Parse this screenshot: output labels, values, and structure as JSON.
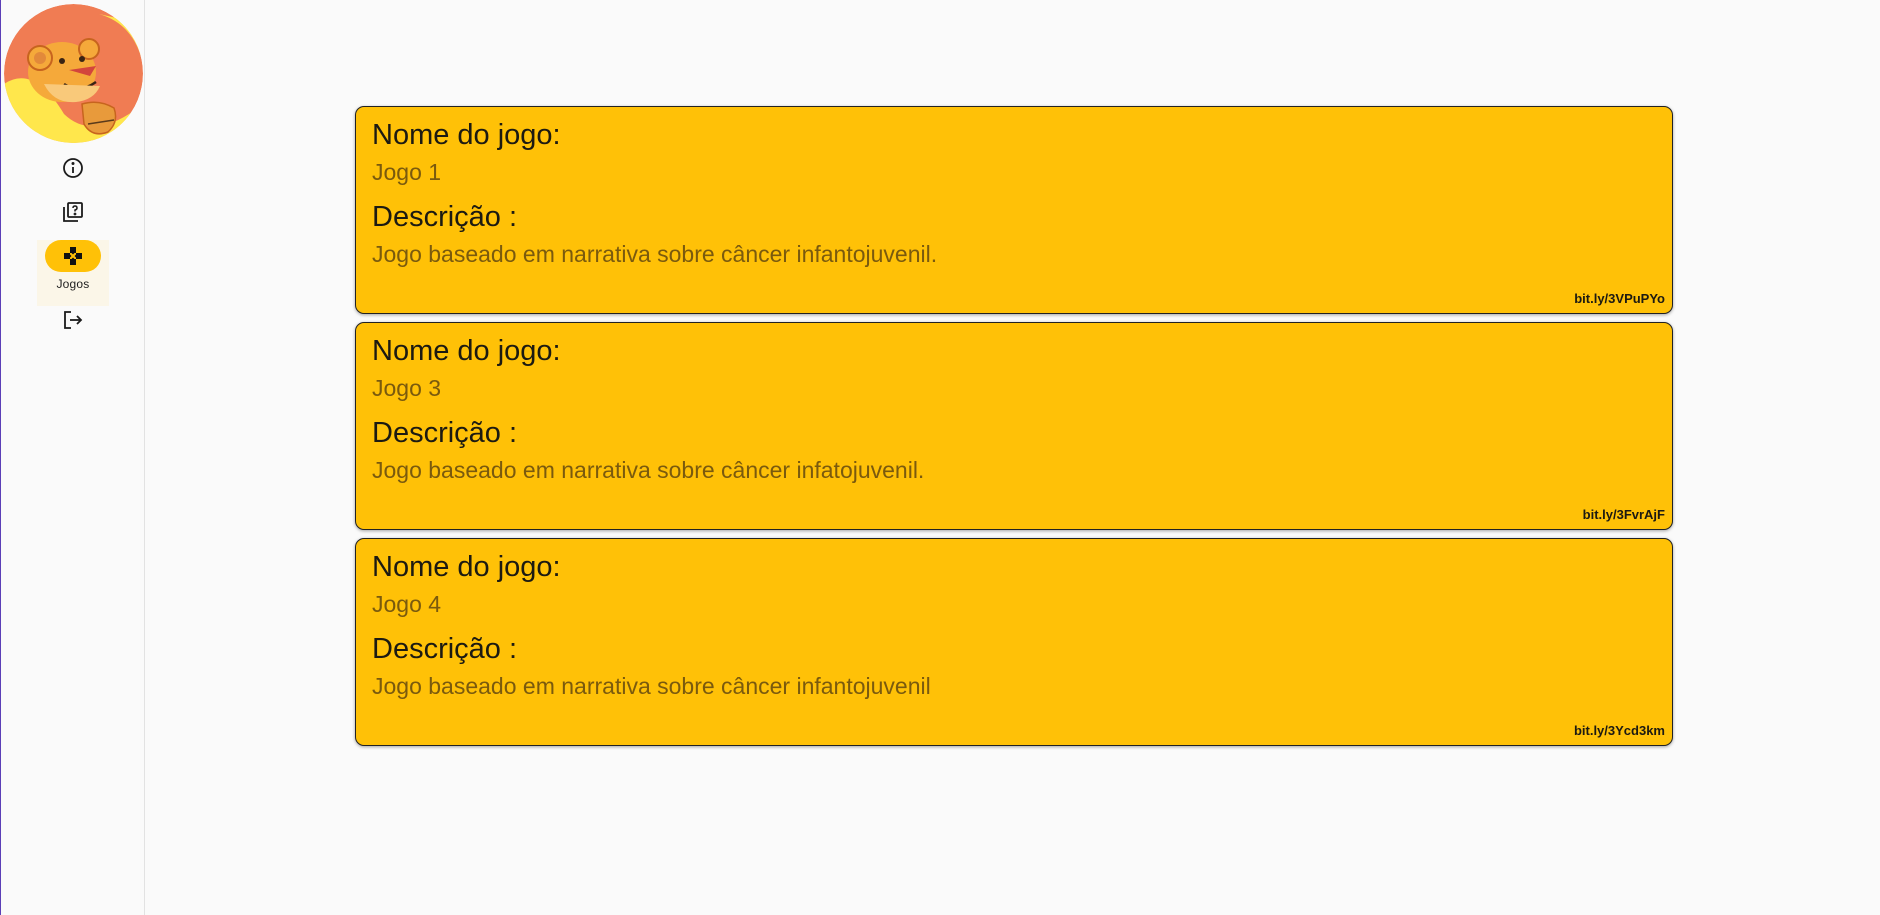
{
  "nav": {
    "items": [
      {
        "icon": "info-icon",
        "label": ""
      },
      {
        "icon": "quiz-icon",
        "label": ""
      },
      {
        "icon": "gamepad-icon",
        "label": "Jogos",
        "active": true
      },
      {
        "icon": "logout-icon",
        "label": ""
      }
    ]
  },
  "cards": [
    {
      "name_title": "Nome do jogo:",
      "name": "Jogo 1",
      "desc_title": "Descrição :",
      "desc": "Jogo baseado em narrativa sobre câncer infantojuvenil.",
      "link": "bit.ly/3VPuPYo"
    },
    {
      "name_title": "Nome do jogo:",
      "name": "Jogo 3",
      "desc_title": "Descrição :",
      "desc": "Jogo baseado em narrativa sobre câncer infatojuvenil.",
      "link": "bit.ly/3FvrAjF"
    },
    {
      "name_title": "Nome do jogo:",
      "name": "Jogo 4",
      "desc_title": "Descrição :",
      "desc": "Jogo baseado em narrativa sobre câncer infantojuvenil",
      "link": "bit.ly/3Ycd3km"
    }
  ],
  "colors": {
    "card_bg": "#ffc107",
    "active_indicator": "#ffc107"
  }
}
